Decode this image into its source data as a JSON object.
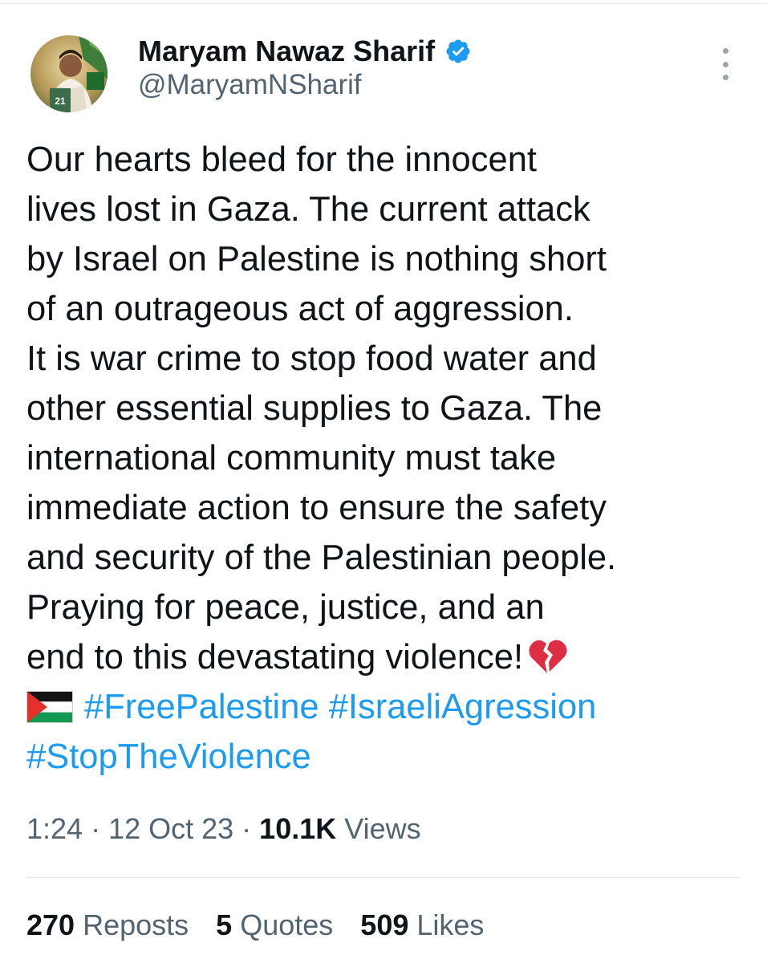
{
  "author": {
    "display_name": "Maryam Nawaz Sharif",
    "handle": "@MaryamNSharif",
    "verified": true,
    "avatar_badge": "21"
  },
  "tweet": {
    "lines": [
      "Our hearts bleed for the innocent",
      "lives lost in Gaza. The current attack",
      "by Israel on Palestine is nothing short",
      "of an outrageous act of aggression.",
      "It is war crime to stop food water and",
      "other essential supplies to Gaza. The",
      "international community must take",
      "immediate action to ensure the safety",
      "and security of the Palestinian people.",
      "Praying for peace, justice, and an",
      "end to this devastating violence!"
    ],
    "emoji_broken_heart": "broken-heart-icon",
    "emoji_flag": "palestine-flag-icon",
    "hashtags": [
      "#FreePalestine",
      "#IsraeliAgression",
      "#StopTheViolence"
    ]
  },
  "meta": {
    "time": "1:24",
    "separator": " · ",
    "date": "12 Oct 23",
    "views_count": "10.1K",
    "views_label": "Views"
  },
  "stats": {
    "reposts_count": "270",
    "reposts_label": "Reposts",
    "quotes_count": "5",
    "quotes_label": "Quotes",
    "likes_count": "509",
    "likes_label": "Likes"
  },
  "colors": {
    "text": "#0f1419",
    "secondary": "#536471",
    "link": "#1d9bf0",
    "verified": "#1d9bf0",
    "divider": "#e6e9eb"
  }
}
